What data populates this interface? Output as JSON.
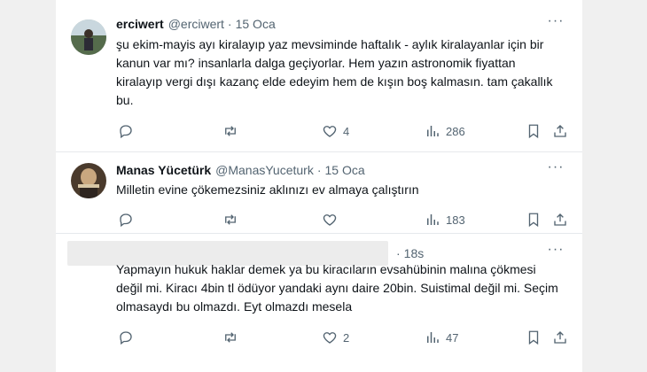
{
  "tweets": [
    {
      "name": "erciwert",
      "handle": "@erciwert",
      "separator": "·",
      "time": "15 Oca",
      "text": "şu ekim-mayis ayı kiralayıp yaz mevsiminde haftalık - aylık kiralayanlar için bir kanun var mı? insanlarla dalga geçiyorlar. Hem yazın astronomik fiyattan kiralayıp vergi dışı kazanç elde edeyim hem de kışın boş kalmasın. tam çakallık bu.",
      "likes": "4",
      "views": "286",
      "more": "···"
    },
    {
      "name": "Manas Yücetürk",
      "handle": "@ManasYuceturk",
      "separator": "·",
      "time": "15 Oca",
      "text": "Milletin evine çökemezsiniz aklınızı ev almaya çalıştırın",
      "views": "183",
      "more": "···"
    },
    {
      "separator": "·",
      "time": "18s",
      "text": "Yapmayın hukuk haklar demek ya bu kiracıların evsahübinin malına çökmesi değil mi. Kiracı 4bin tl ödüyor yandaki aynı daire 20bin. Suistimal değil mi. Seçim olmasaydı bu olmazdı. Eyt olmazdı mesela",
      "likes": "2",
      "views": "47",
      "more": "···"
    }
  ],
  "colors": {
    "text": "#0f1419",
    "muted": "#536471",
    "border": "#e6e9ec",
    "background": "#ffffff"
  }
}
